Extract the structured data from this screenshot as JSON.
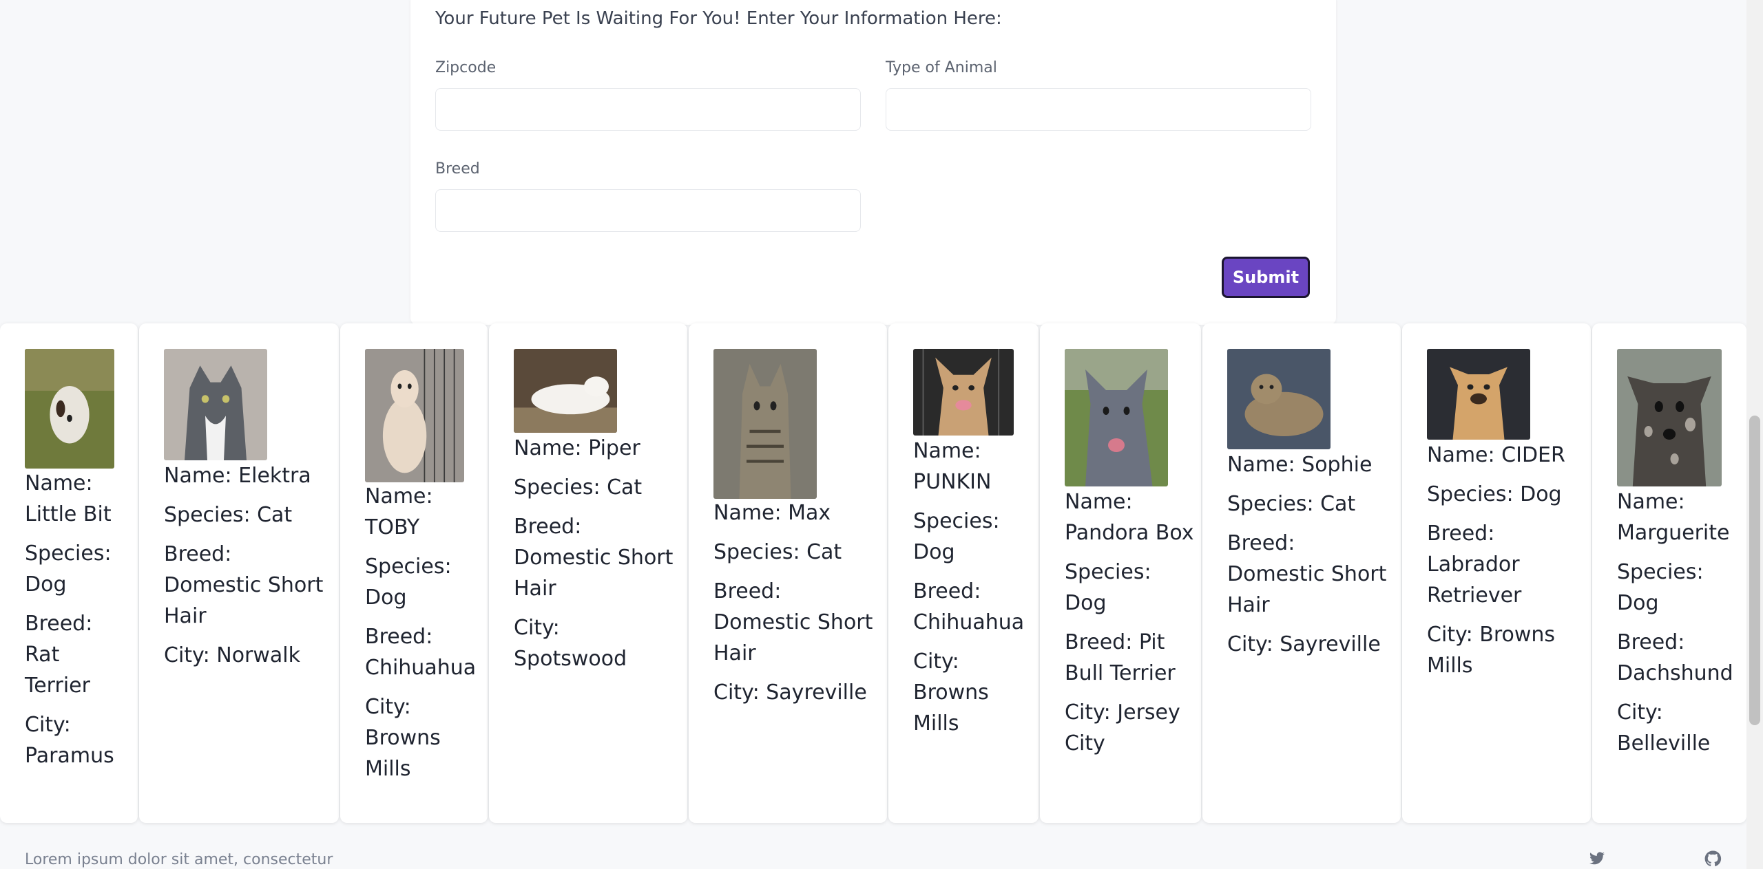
{
  "form": {
    "title": "Your Future Pet Is Waiting For You! Enter Your Information Here:",
    "zipcode_label": "Zipcode",
    "zipcode_value": "",
    "animal_label": "Type of Animal",
    "animal_value": "",
    "breed_label": "Breed",
    "breed_value": "",
    "submit_label": "Submit"
  },
  "pets": [
    {
      "name": "Name: Little Bit",
      "species": "Species: Dog",
      "breed": "Breed: Rat Terrier",
      "city": "City: Paramus",
      "photo_icon": "dog-photo"
    },
    {
      "name": "Name: Elektra",
      "species": "Species: Cat",
      "breed": "Breed: Domestic Short Hair",
      "city": "City: Norwalk",
      "photo_icon": "cat-photo"
    },
    {
      "name": "Name: TOBY",
      "species": "Species: Dog",
      "breed": "Breed: Chihuahua",
      "city": "City: Browns Mills",
      "photo_icon": "dog-photo"
    },
    {
      "name": "Name: Piper",
      "species": "Species: Cat",
      "breed": "Breed: Domestic Short Hair",
      "city": "City: Spotswood",
      "photo_icon": "cat-photo"
    },
    {
      "name": "Name: Max",
      "species": "Species: Cat",
      "breed": "Breed: Domestic Short Hair",
      "city": "City: Sayreville",
      "photo_icon": "cat-photo"
    },
    {
      "name": "Name: PUNKIN",
      "species": "Species: Dog",
      "breed": "Breed: Chihuahua",
      "city": "City: Browns Mills",
      "photo_icon": "dog-photo"
    },
    {
      "name": "Name: Pandora Box",
      "species": "Species: Dog",
      "breed": "Breed: Pit Bull Terrier",
      "city": "City: Jersey City",
      "photo_icon": "dog-photo"
    },
    {
      "name": "Name: Sophie",
      "species": "Species: Cat",
      "breed": "Breed: Domestic Short Hair",
      "city": "City: Sayreville",
      "photo_icon": "cat-photo"
    },
    {
      "name": "Name: CIDER",
      "species": "Species: Dog",
      "breed": "Breed: Labrador Retriever",
      "city": "City: Browns Mills",
      "photo_icon": "dog-photo"
    },
    {
      "name": "Name: Marguerite",
      "species": "Species: Dog",
      "breed": "Breed: Dachshund",
      "city": "City: Belleville",
      "photo_icon": "dog-photo"
    }
  ],
  "footer": {
    "text": "Lorem ipsum dolor sit amet, consectetur",
    "icons": [
      "twitter-icon",
      "github-icon"
    ]
  },
  "colors": {
    "background": "#f7f8fa",
    "submit_bg": "#6a45c2",
    "card_bg": "#ffffff"
  }
}
